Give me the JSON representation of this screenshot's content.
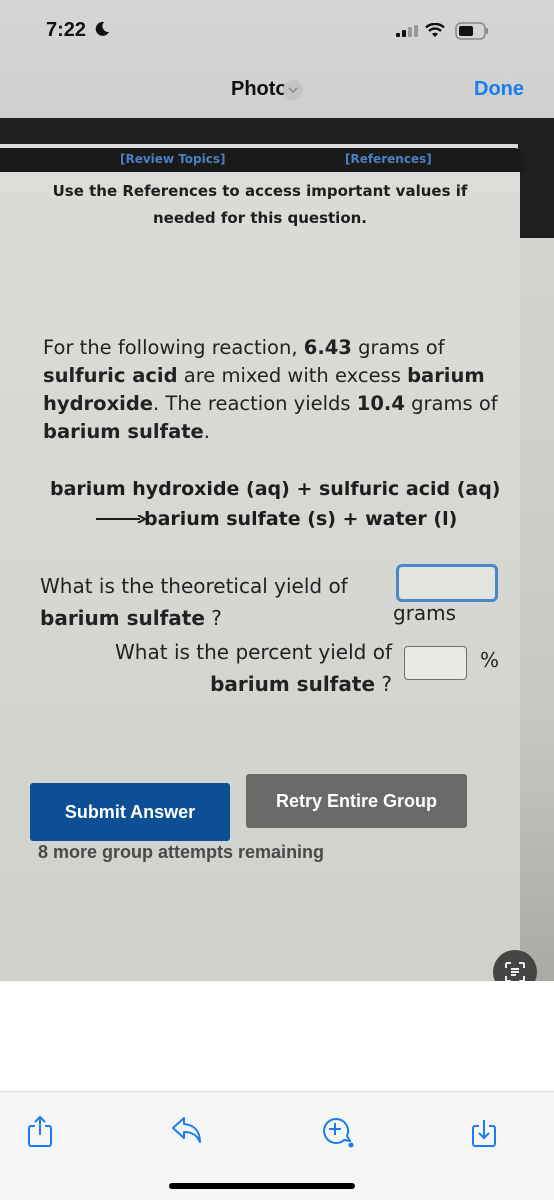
{
  "status_bar": {
    "time": "7:22",
    "icons": [
      "moon-icon",
      "signal-icon",
      "wifi-icon",
      "battery-icon"
    ]
  },
  "nav": {
    "title": "Photo",
    "done_label": "Done",
    "accent_color": "#1a7cf0"
  },
  "photo_content": {
    "links": {
      "review_topics": "[Review Topics]",
      "references": "[References]"
    },
    "instructions": "Use the References to access important values if needed for this question.",
    "problem": {
      "part1": "For the following reaction, ",
      "mass_reactant": "6.43",
      "part2": " grams of ",
      "reactant": "sulfuric acid",
      "part3": " are mixed with excess ",
      "excess_reactant": "barium hydroxide",
      "part4": ". The reaction yields ",
      "mass_product": "10.4",
      "part5": " grams of ",
      "product": "barium sulfate",
      "part6": "."
    },
    "equation": {
      "reactants": "barium hydroxide (aq) + sulfuric acid (aq)",
      "products": "barium sulfate (s) + water (l)"
    },
    "question_theoretical": {
      "text": "What is the theoretical yield of",
      "subject": "barium sulfate",
      "suffix": " ?",
      "value": "",
      "unit": "grams"
    },
    "question_percent": {
      "text": "What is the percent yield of",
      "subject": "barium sulfate",
      "suffix": " ?",
      "value": "",
      "unit": "%"
    },
    "buttons": {
      "submit": "Submit Answer",
      "retry": "Retry Entire Group"
    },
    "attempts_remaining": "8 more group attempts remaining",
    "colors": {
      "submit": "#0d4f94",
      "retry": "#6a6a68",
      "focused_input_border": "#4a86c8"
    }
  },
  "live_text_icon": "live-text-icon",
  "toolbar": {
    "items": [
      {
        "name": "share",
        "icon": "share-icon"
      },
      {
        "name": "reply",
        "icon": "reply-icon"
      },
      {
        "name": "markup",
        "icon": "markup-icon"
      },
      {
        "name": "save",
        "icon": "save-to-files-icon"
      }
    ]
  }
}
